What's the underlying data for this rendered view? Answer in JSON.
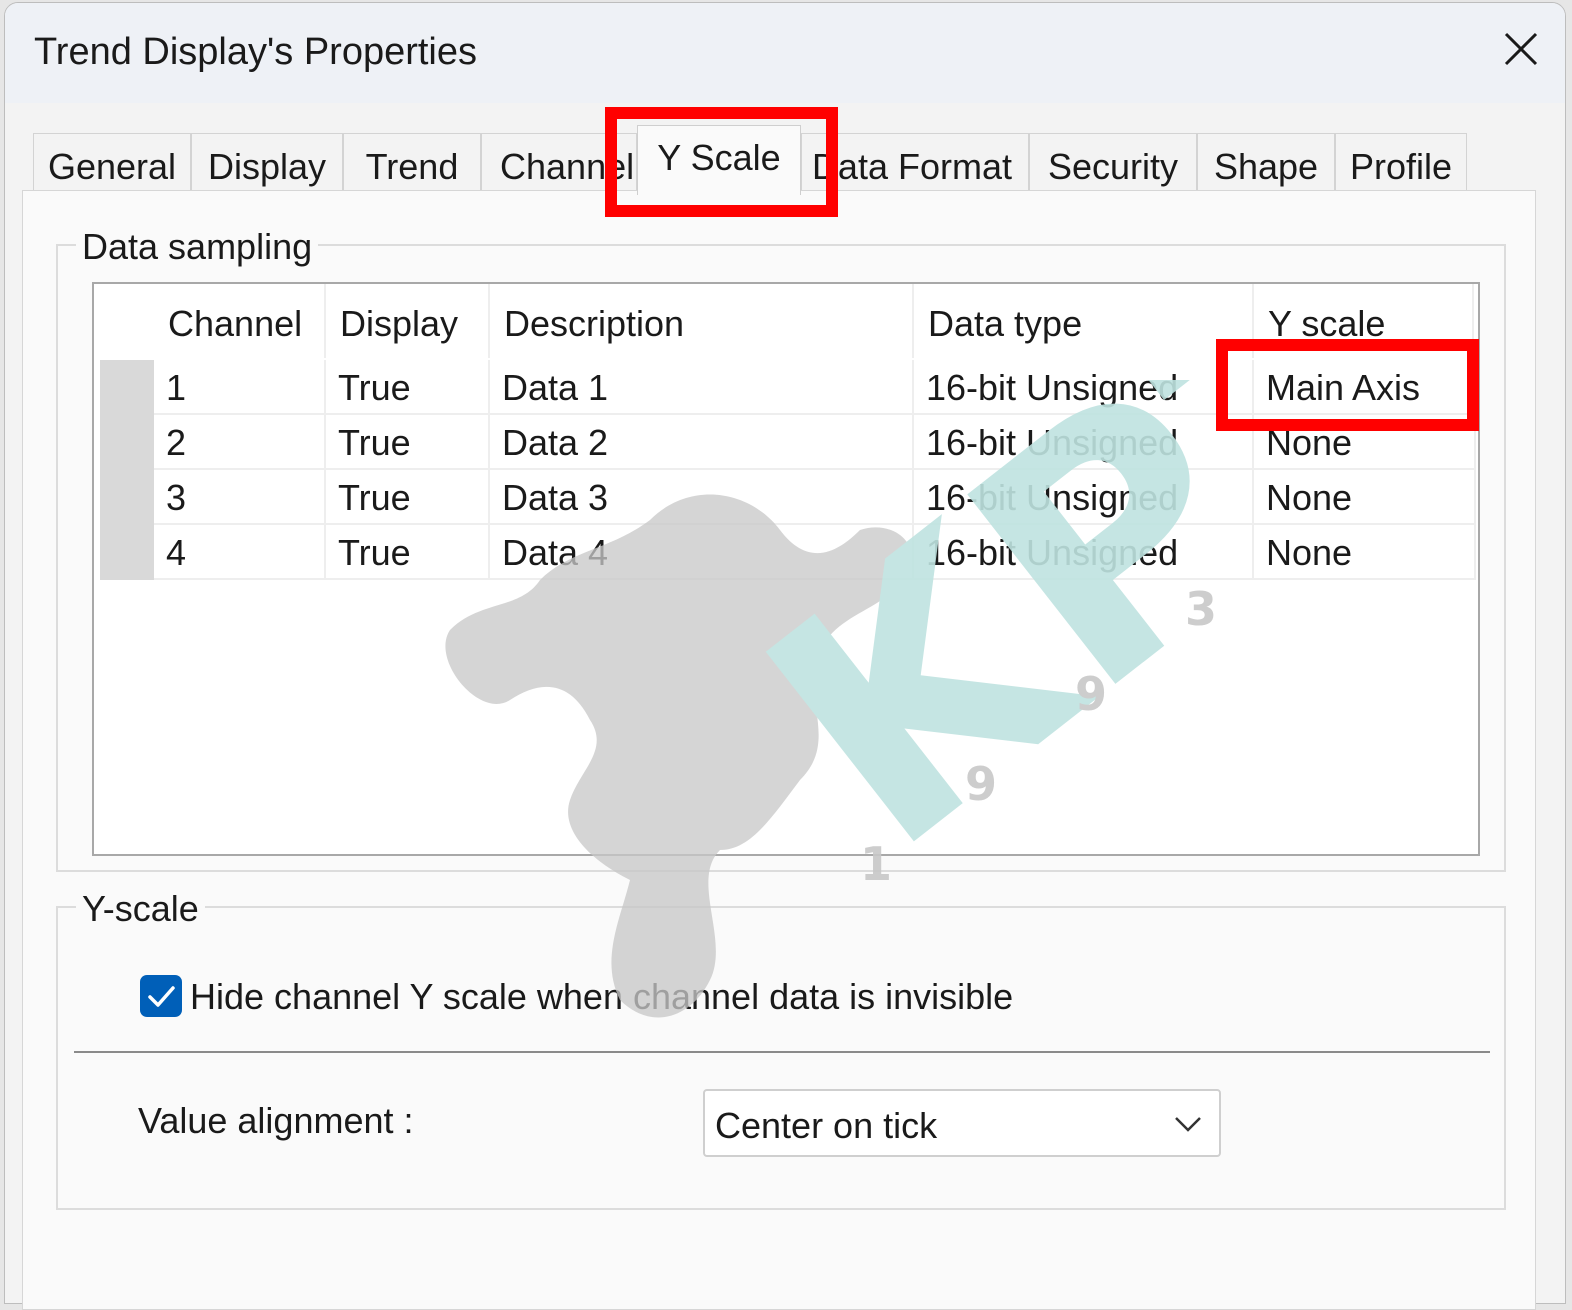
{
  "window": {
    "title": "Trend Display's Properties"
  },
  "tabs": [
    {
      "label": "General"
    },
    {
      "label": "Display"
    },
    {
      "label": "Trend"
    },
    {
      "label": "Channel"
    },
    {
      "label": "Y Scale"
    },
    {
      "label": "Data Format"
    },
    {
      "label": "Security"
    },
    {
      "label": "Shape"
    },
    {
      "label": "Profile"
    }
  ],
  "active_tab": "Y Scale",
  "data_sampling": {
    "group_label": "Data sampling",
    "columns": [
      "Channel",
      "Display",
      "Description",
      "Data type",
      "Y scale"
    ],
    "rows": [
      {
        "channel": "1",
        "display": "True",
        "description": "Data 1",
        "data_type": "16-bit Unsigned",
        "y_scale": "Main Axis"
      },
      {
        "channel": "2",
        "display": "True",
        "description": "Data 2",
        "data_type": "16-bit Unsigned",
        "y_scale": "None"
      },
      {
        "channel": "3",
        "display": "True",
        "description": "Data 3",
        "data_type": "16-bit Unsigned",
        "y_scale": "None"
      },
      {
        "channel": "4",
        "display": "True",
        "description": "Data 4",
        "data_type": "16-bit Unsigned",
        "y_scale": "None"
      }
    ]
  },
  "y_scale": {
    "group_label": "Y-scale",
    "hide_checkbox": {
      "label": "Hide channel Y scale when channel data is invisible",
      "checked": true
    },
    "value_alignment": {
      "label": "Value alignment :",
      "value": "Center on tick"
    }
  },
  "watermark": {
    "text": "KPT",
    "digits": [
      "1",
      "9",
      "9",
      "3"
    ]
  },
  "colors": {
    "highlight": "#ff0000",
    "checkbox": "#005fb8",
    "watermark_teal": "#bfe3e0",
    "watermark_gray": "#c8c8c8"
  }
}
